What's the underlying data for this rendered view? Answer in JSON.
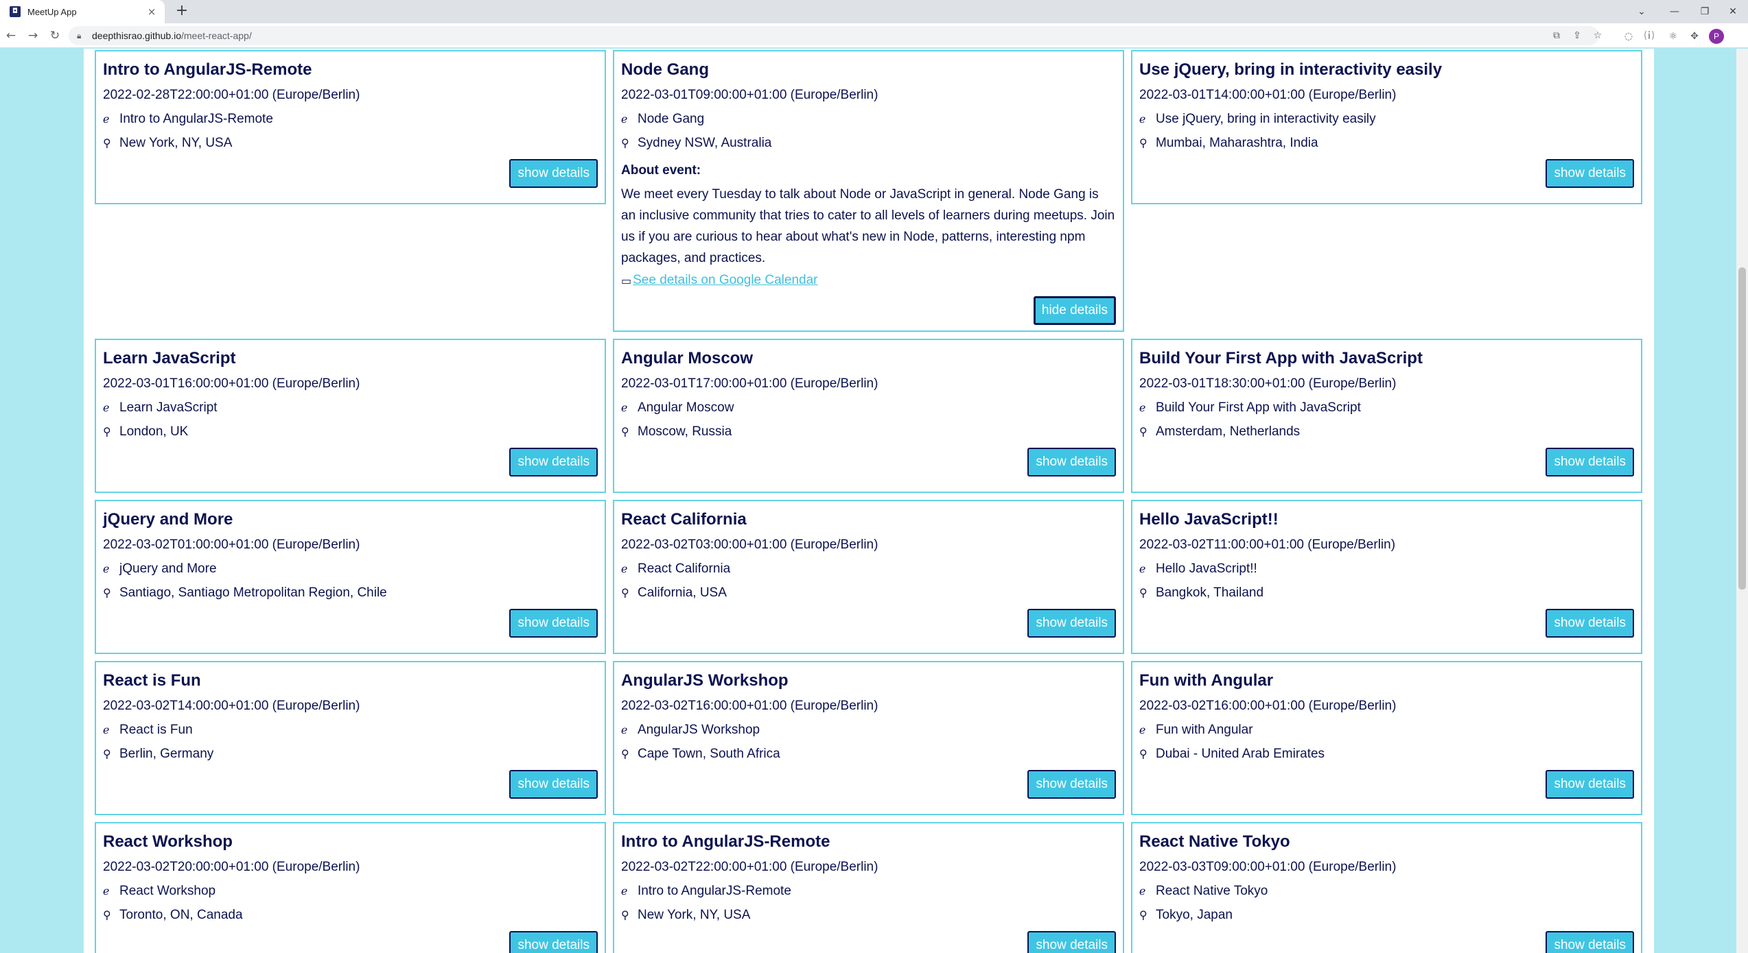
{
  "browser": {
    "tab_title": "MeetUp App",
    "favicon_glyph": "◘",
    "close_glyph": "×",
    "newtab_glyph": "+",
    "url_host": "deepthisrao.github.io",
    "url_path": "/meet-react-app/",
    "profile_initial": "P",
    "window_controls": [
      "⌄",
      "—",
      "❐",
      "✕"
    ]
  },
  "icons": {
    "event_icon": "ℯ",
    "location_icon": "⚲",
    "calendar_icon": "▭"
  },
  "button_labels": {
    "show": "show details",
    "hide": "hide details"
  },
  "about_label": "About event:",
  "calendar_link": "See details on Google Calendar",
  "events": [
    {
      "title": "Intro to AngularJS-Remote",
      "datetime": "2022-02-28T22:00:00+01:00 (Europe/Berlin)",
      "summary": "Intro to AngularJS-Remote",
      "location": "New York, NY, USA",
      "button": "show details"
    },
    {
      "title": "Node Gang",
      "datetime": "2022-03-01T09:00:00+01:00 (Europe/Berlin)",
      "summary": "Node Gang",
      "location": "Sydney NSW, Australia",
      "button": "hide details",
      "description": "We meet every Tuesday to talk about Node or JavaScript in general. Node Gang is an inclusive community that tries to cater to all levels of learners during meetups. Join us if you are curious to hear about what's new in Node, patterns, interesting npm packages, and practices."
    },
    {
      "title": "Use jQuery, bring in interactivity easily",
      "datetime": "2022-03-01T14:00:00+01:00 (Europe/Berlin)",
      "summary": "Use jQuery, bring in interactivity easily",
      "location": "Mumbai, Maharashtra, India",
      "button": "show details"
    },
    {
      "title": "Learn JavaScript",
      "datetime": "2022-03-01T16:00:00+01:00 (Europe/Berlin)",
      "summary": "Learn JavaScript",
      "location": "London, UK",
      "button": "show details"
    },
    {
      "title": "Angular Moscow",
      "datetime": "2022-03-01T17:00:00+01:00 (Europe/Berlin)",
      "summary": "Angular Moscow",
      "location": "Moscow, Russia",
      "button": "show details"
    },
    {
      "title": "Build Your First App with JavaScript",
      "datetime": "2022-03-01T18:30:00+01:00 (Europe/Berlin)",
      "summary": "Build Your First App with JavaScript",
      "location": "Amsterdam, Netherlands",
      "button": "show details"
    },
    {
      "title": "jQuery and More",
      "datetime": "2022-03-02T01:00:00+01:00 (Europe/Berlin)",
      "summary": "jQuery and More",
      "location": "Santiago, Santiago Metropolitan Region, Chile",
      "button": "show details"
    },
    {
      "title": "React California",
      "datetime": "2022-03-02T03:00:00+01:00 (Europe/Berlin)",
      "summary": "React California",
      "location": "California, USA",
      "button": "show details"
    },
    {
      "title": "Hello JavaScript!!",
      "datetime": "2022-03-02T11:00:00+01:00 (Europe/Berlin)",
      "summary": "Hello JavaScript!!",
      "location": "Bangkok, Thailand",
      "button": "show details"
    },
    {
      "title": "React is Fun",
      "datetime": "2022-03-02T14:00:00+01:00 (Europe/Berlin)",
      "summary": "React is Fun",
      "location": "Berlin, Germany",
      "button": "show details"
    },
    {
      "title": "AngularJS Workshop",
      "datetime": "2022-03-02T16:00:00+01:00 (Europe/Berlin)",
      "summary": "AngularJS Workshop",
      "location": "Cape Town, South Africa",
      "button": "show details"
    },
    {
      "title": "Fun with Angular",
      "datetime": "2022-03-02T16:00:00+01:00 (Europe/Berlin)",
      "summary": "Fun with Angular",
      "location": "Dubai - United Arab Emirates",
      "button": "show details"
    },
    {
      "title": "React Workshop",
      "datetime": "2022-03-02T20:00:00+01:00 (Europe/Berlin)",
      "summary": "React Workshop",
      "location": "Toronto, ON, Canada",
      "button": "show details"
    },
    {
      "title": "Intro to AngularJS-Remote",
      "datetime": "2022-03-02T22:00:00+01:00 (Europe/Berlin)",
      "summary": "Intro to AngularJS-Remote",
      "location": "New York, NY, USA",
      "button": "show details"
    },
    {
      "title": "React Native Tokyo",
      "datetime": "2022-03-03T09:00:00+01:00 (Europe/Berlin)",
      "summary": "React Native Tokyo",
      "location": "Tokyo, Japan",
      "button": "show details"
    }
  ],
  "colors": {
    "page_background": "#aee9f2",
    "card_border": "#64d2e6",
    "text": "#0c1350",
    "button": "#3fc5e3",
    "link": "#3fbfdc"
  }
}
